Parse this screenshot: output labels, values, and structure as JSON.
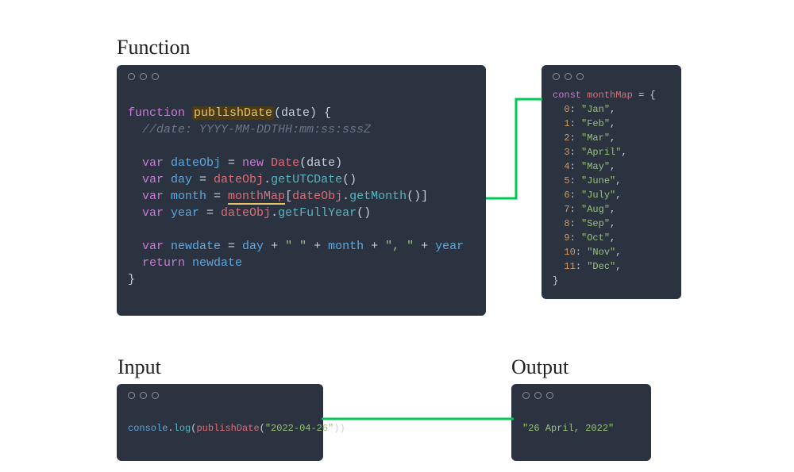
{
  "headings": {
    "function": "Function",
    "input": "Input",
    "output": "Output"
  },
  "functionCode": {
    "line1_function": "function ",
    "line1_name": "publishDate",
    "line1_rest": "(date) {",
    "line2_comment": "  //date: YYYY-MM-DDTHH:mm:ss:sssZ",
    "line3": "",
    "line4_var": "  var ",
    "line4_name": "dateObj",
    "line4_eq": " = ",
    "line4_new": "new ",
    "line4_date": "Date",
    "line4_rest": "(date)",
    "line5_var": "  var ",
    "line5_name": "day",
    "line5_eq": " = ",
    "line5_obj": "dateObj",
    "line5_dot": ".",
    "line5_method": "getUTCDate",
    "line5_rest": "()",
    "line6_var": "  var ",
    "line6_name": "month",
    "line6_eq": " = ",
    "line6_map": "monthMap",
    "line6_br1": "[",
    "line6_obj": "dateObj",
    "line6_dot": ".",
    "line6_method": "getMonth",
    "line6_rest": "()]",
    "line7_var": "  var ",
    "line7_name": "year",
    "line7_eq": " = ",
    "line7_obj": "dateObj",
    "line7_dot": ".",
    "line7_method": "getFullYear",
    "line7_rest": "()",
    "line8": "",
    "line9_var": "  var ",
    "line9_name": "newdate",
    "line9_eq": " = ",
    "line9_day": "day",
    "line9_p1": " + ",
    "line9_s1": "\" \"",
    "line9_p2": " + ",
    "line9_month": "month",
    "line9_p3": " + ",
    "line9_s2": "\", \"",
    "line9_p4": " + ",
    "line9_year": "year",
    "line10_return": "  return ",
    "line10_val": "newdate",
    "line11": "}"
  },
  "monthMap": {
    "decl_const": "const ",
    "decl_name": "monthMap",
    "decl_eq": " = {",
    "entries": [
      {
        "k": "0",
        "v": "\"Jan\""
      },
      {
        "k": "1",
        "v": "\"Feb\""
      },
      {
        "k": "2",
        "v": "\"Mar\""
      },
      {
        "k": "3",
        "v": "\"April\""
      },
      {
        "k": "4",
        "v": "\"May\""
      },
      {
        "k": "5",
        "v": "\"June\""
      },
      {
        "k": "6",
        "v": "\"July\""
      },
      {
        "k": "7",
        "v": "\"Aug\""
      },
      {
        "k": "8",
        "v": "\"Sep\""
      },
      {
        "k": "9",
        "v": "\"Oct\""
      },
      {
        "k": "10",
        "v": "\"Nov\""
      },
      {
        "k": "11",
        "v": "\"Dec\""
      }
    ],
    "close": "}"
  },
  "input": {
    "console": "console",
    "dot1": ".",
    "log": "log",
    "p1": "(",
    "fn": "publishDate",
    "p2": "(",
    "arg": "\"2022-04-26\"",
    "p3": "))"
  },
  "output": {
    "value": "\"26 April, 2022\""
  }
}
